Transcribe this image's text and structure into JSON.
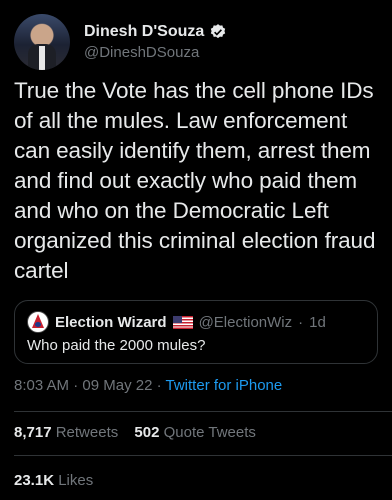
{
  "author": {
    "display_name": "Dinesh D'Souza",
    "handle": "@DineshDSouza"
  },
  "tweet": {
    "text": "True the Vote has the cell phone IDs of all the mules. Law enforcement can easily identify them, arrest them and find out exactly who paid them and who on the Democratic Left organized this criminal election fraud cartel"
  },
  "quote": {
    "display_name": "Election Wizard",
    "handle": "@ElectionWiz",
    "time_sep": "·",
    "age": "1d",
    "text": "Who paid the 2000 mules?"
  },
  "meta": {
    "time": "8:03 AM",
    "sep": "·",
    "date": "09 May 22",
    "source": "Twitter for iPhone"
  },
  "stats": {
    "retweets_count": "8,717",
    "retweets_label": "Retweets",
    "quotes_count": "502",
    "quotes_label": "Quote Tweets",
    "likes_count": "23.1K",
    "likes_label": "Likes"
  },
  "colors": {
    "background": "#000000",
    "text": "#e7e9ea",
    "secondary": "#71767b",
    "accent": "#1d9bf0",
    "divider": "#2f3336"
  }
}
